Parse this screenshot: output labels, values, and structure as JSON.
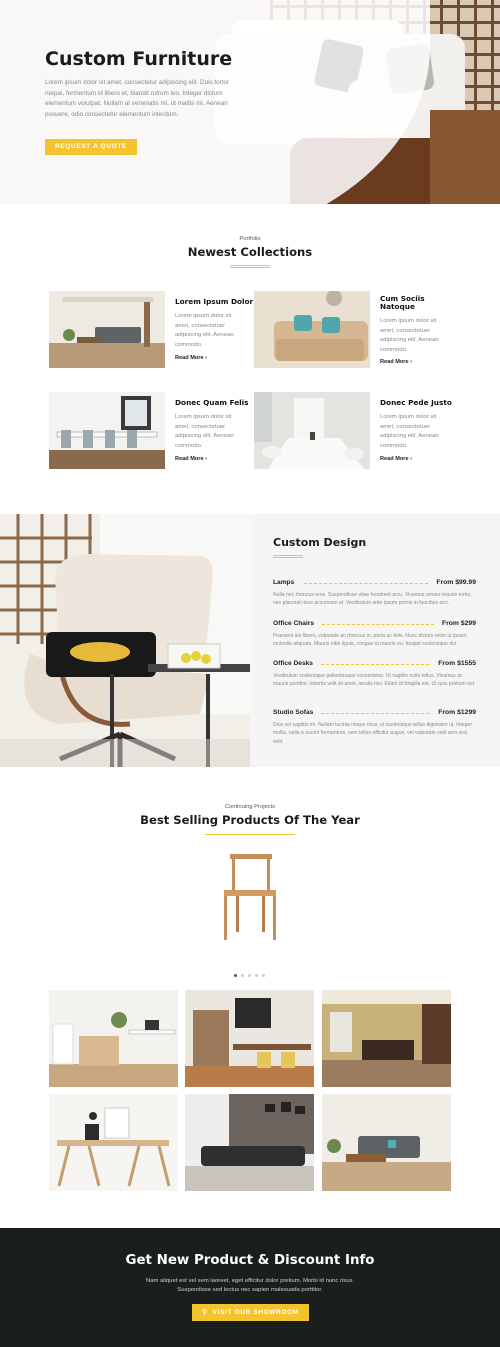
{
  "hero": {
    "title": "Custom Furniture",
    "text": "Lorem ipsum dolor sit amet, consectetur adipiscing elit. Duis tortor neque, fermentum id libero et, blandit rutrum leo. Integer dictum elementum volutpat. Nullam at venenatis mi, ut mattis mi. Aenean posuere, odio consectetur elementum interdum.",
    "button": "REQUEST A QUOTE"
  },
  "portfolio": {
    "kicker": "Portfolio",
    "title": "Newest Collections",
    "cards": [
      {
        "title": "Lorem Ipsum Dolor",
        "desc": "Lorem ipsum dolor sit amet, consectetuer adipiscing elit. Aenean commodo.",
        "more": "Read More"
      },
      {
        "title": "Cum Sociis Natoque",
        "desc": "Lorem ipsum dolor sit amet, consectetuer adipiscing elit. Aenean commodo.",
        "more": "Read More"
      },
      {
        "title": "Donec Quam Felis",
        "desc": "Lorem ipsum dolor sit amet, consectetuer adipiscing elit. Aenean commodo.",
        "more": "Read More"
      },
      {
        "title": "Donec Pede Justo",
        "desc": "Lorem ipsum dolor sit amet, consectetuer adipiscing elit. Aenean commodo.",
        "more": "Read More"
      }
    ]
  },
  "design": {
    "title": "Custom Design",
    "items": [
      {
        "name": "Lamps",
        "price": "From $99.99",
        "desc": "Nulla nec rhoncus eros. Suspendisse vitae hendrerit arcu. Vivamus ornare mauris tortor, nec placerat risus accumsan at. Vestibulum ante ipsum primis in faucibus orci."
      },
      {
        "name": "Office Chairs",
        "price": "From $299",
        "desc": "Praesent leo libero, vulputate ac rhoncus in, porta ac felis. Nunc dictum enim ut ipsum molestie aliquam. Mauris nibh ligula, congue ut mauris eu, feugiat scelerisque dui."
      },
      {
        "name": "Office Desks",
        "price": "From $1555",
        "desc": "Vestibulum scelerisque pellentesque consectetur. Ut sagittis nulla tellus. Vivamus ac mauris porttitor, lobortis velit sit amet, iaculis nisi. Etiam id fringilla est. Ut quis pretium est."
      },
      {
        "name": "Studio Sofas",
        "price": "From $1299",
        "desc": "Duis vel sagittis mi. Nullam lacinia neque risus, ut scelerisque tellus dignissim ut. Integer mollis, nulla a auctor fermentum, sem tellus efficitur augue, vel vulputate velit sem sed velit."
      }
    ]
  },
  "projects": {
    "kicker": "Continuing Projects",
    "title": "Best Selling Products Of The Year",
    "slider_dots": 5,
    "slider_active": 1
  },
  "footer": {
    "title": "Get New Product & Discount Info",
    "text": "Nam aliquet est vel sem laoreet, eget efficitur dolor pretium. Morbi id nunc risus. Suspendisse sed lectus nec sapien malesuada porttitor.",
    "button": "VISIT OUR SHOWROOM"
  },
  "colors": {
    "accent": "#f4c430",
    "footer_bg": "#1a1f1d",
    "panel_bg": "#f5f5f5"
  }
}
